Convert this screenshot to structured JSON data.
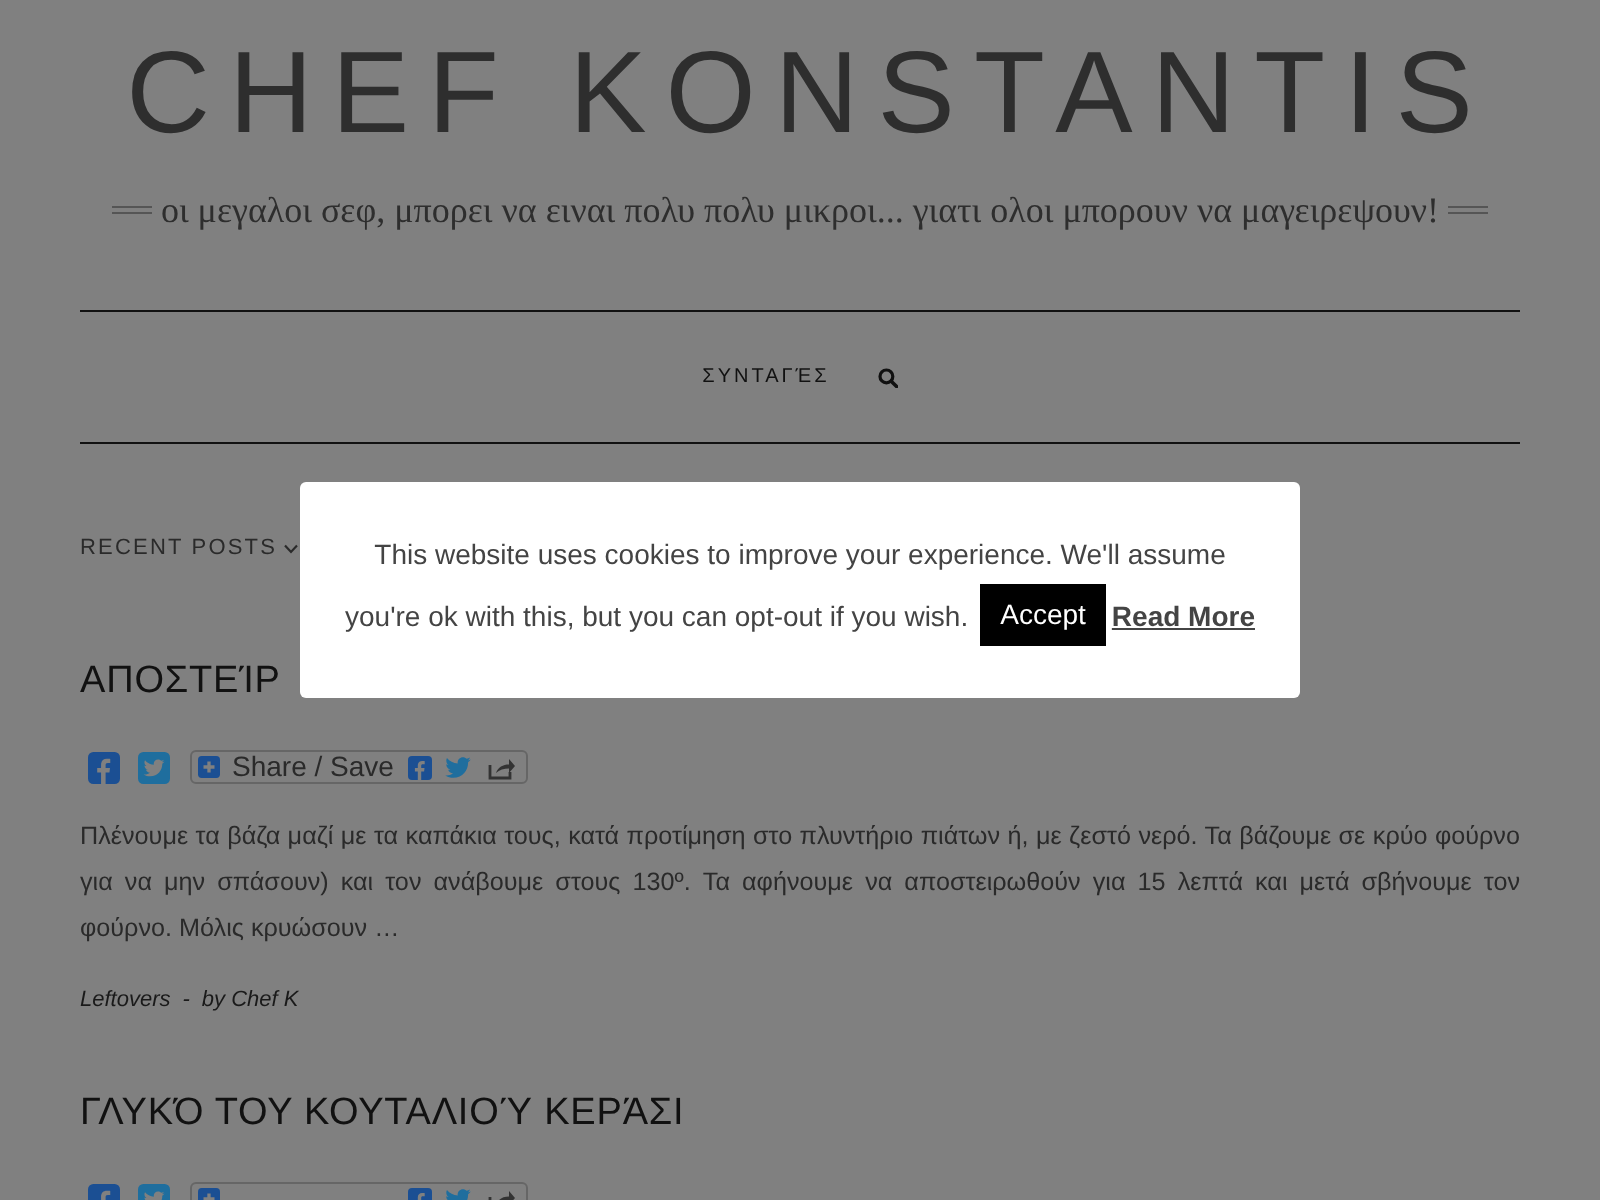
{
  "site": {
    "title": "CHEF KONSTANTIS",
    "tagline": "οι μεγαλοι σεφ, μπορει να ειναι πολυ πολυ μικροι... γιατι ολοι μπορουν να μαγειρεψουν!"
  },
  "nav": {
    "items": [
      {
        "label": "ΣΥΝΤΑΓΈΣ"
      }
    ]
  },
  "section_heading": "RECENT POSTS",
  "posts": [
    {
      "title": "ΑΠΟΣΤΕΊΡ",
      "share_label": "Share / Save",
      "excerpt": "Πλένουμε τα βάζα μαζί με τα καπάκια τους, κατά προτίμηση στο πλυντήριο πιάτων ή, με ζεστό νερό. Τα βάζουμε σε κρύο φούρνο για να μην σπάσουν) και τον ανάβουμε στους 130º. Τα αφήνουμε να αποστειρωθούν για 15 λεπτά και μετά σβήνουμε τον φούρνο. Μόλις κρυώσουν …",
      "category": "Leftovers",
      "separator": "-",
      "author": "by Chef K"
    },
    {
      "title": "ΓΛΥΚΌ ΤΟΥ ΚΟΥΤΑΛΙΟΎ ΚΕΡΆΣΙ"
    }
  ],
  "cookie_notice": {
    "message_lines": [
      "This website uses cookies to improve your experience. We'll assume",
      "you're ok with this, but you can opt-out if you wish."
    ],
    "accept": "Accept",
    "read_more": "Read More"
  }
}
